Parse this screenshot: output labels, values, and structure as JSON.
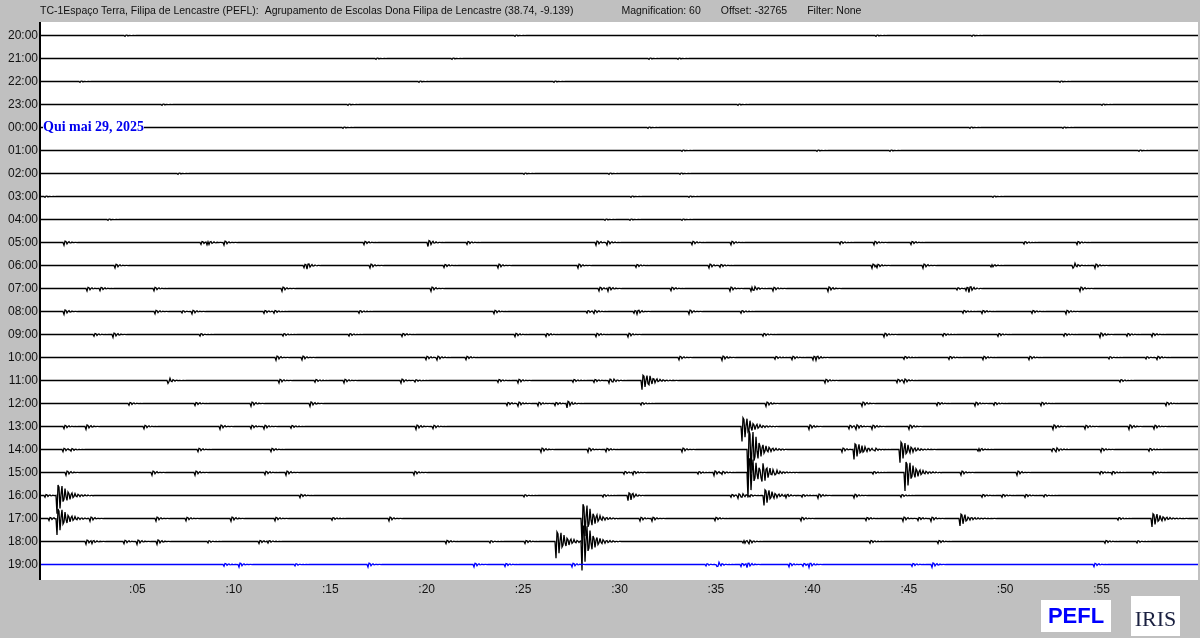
{
  "header": {
    "station": "TC-1Espaço Terra, Filipa de Lencastre (PEFL):",
    "location": "Agrupamento de Escolas Dona Filipa de Lencastre (38.74, -9.139)",
    "magnification": "Magnification: 60",
    "offset": "Offset: -32765",
    "filter": "Filter: None"
  },
  "rows": [
    {
      "time": "20:00",
      "color": "#000000"
    },
    {
      "time": "21:00",
      "color": "#000000"
    },
    {
      "time": "22:00",
      "color": "#000000"
    },
    {
      "time": "23:00",
      "color": "#000000"
    },
    {
      "time": "00:00",
      "color": "#000000",
      "date": "Qui mai 29, 2025"
    },
    {
      "time": "01:00",
      "color": "#000000"
    },
    {
      "time": "02:00",
      "color": "#000000"
    },
    {
      "time": "03:00",
      "color": "#000000"
    },
    {
      "time": "04:00",
      "color": "#000000"
    },
    {
      "time": "05:00",
      "color": "#000000"
    },
    {
      "time": "06:00",
      "color": "#000000"
    },
    {
      "time": "07:00",
      "color": "#000000"
    },
    {
      "time": "08:00",
      "color": "#000000"
    },
    {
      "time": "09:00",
      "color": "#000000"
    },
    {
      "time": "10:00",
      "color": "#000000"
    },
    {
      "time": "11:00",
      "color": "#000000"
    },
    {
      "time": "12:00",
      "color": "#000000"
    },
    {
      "time": "13:00",
      "color": "#000000"
    },
    {
      "time": "14:00",
      "color": "#000000"
    },
    {
      "time": "15:00",
      "color": "#000000"
    },
    {
      "time": "16:00",
      "color": "#000000"
    },
    {
      "time": "17:00",
      "color": "#000000"
    },
    {
      "time": "18:00",
      "color": "#000000"
    },
    {
      "time": "19:00",
      "color": "#0000ff"
    }
  ],
  "x_ticks": [
    ":05",
    ":10",
    ":15",
    ":20",
    ":25",
    ":30",
    ":35",
    ":40",
    ":45",
    ":50",
    ":55"
  ],
  "logos": {
    "station": "PEFL",
    "network": "IRIS"
  }
}
